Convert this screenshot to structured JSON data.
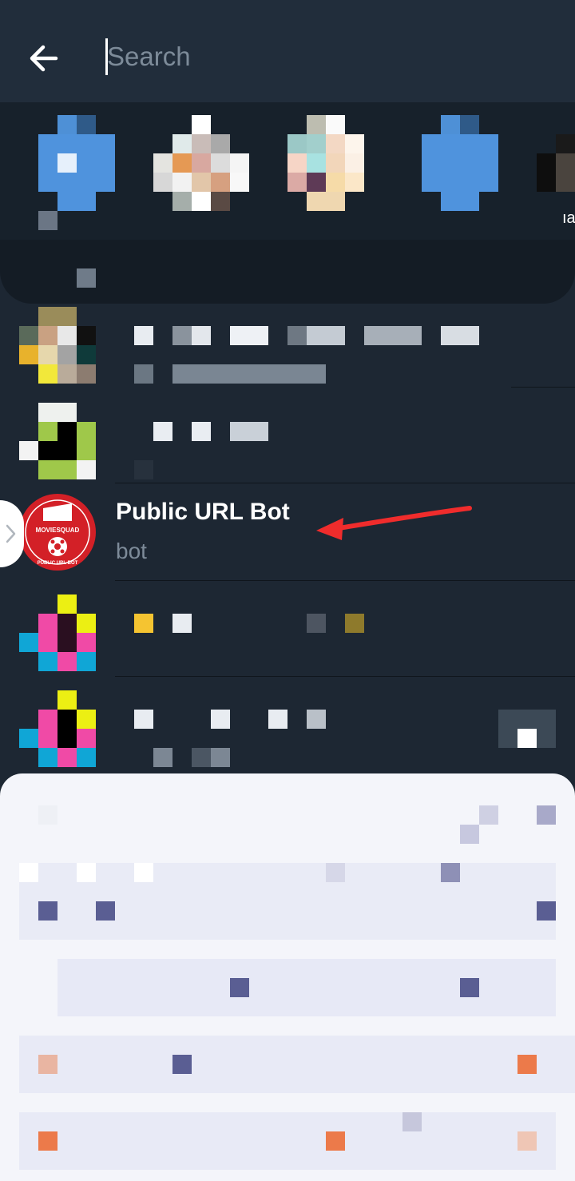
{
  "header": {
    "back_icon": "arrow-left-icon",
    "search_placeholder": "Search",
    "search_value": ""
  },
  "stories": {
    "partial_label": "ıa"
  },
  "results": [
    {
      "title": "Public URL Bot",
      "subtitle": "bot",
      "avatar_text_top": "MOVIESQUAD",
      "avatar_text_bottom": "PUBLIC URL BOT",
      "avatar_color": "#d32027"
    }
  ],
  "annotation": {
    "arrow_color": "#f02c2c"
  },
  "swipe_handle_icon": "chevron-right-icon"
}
